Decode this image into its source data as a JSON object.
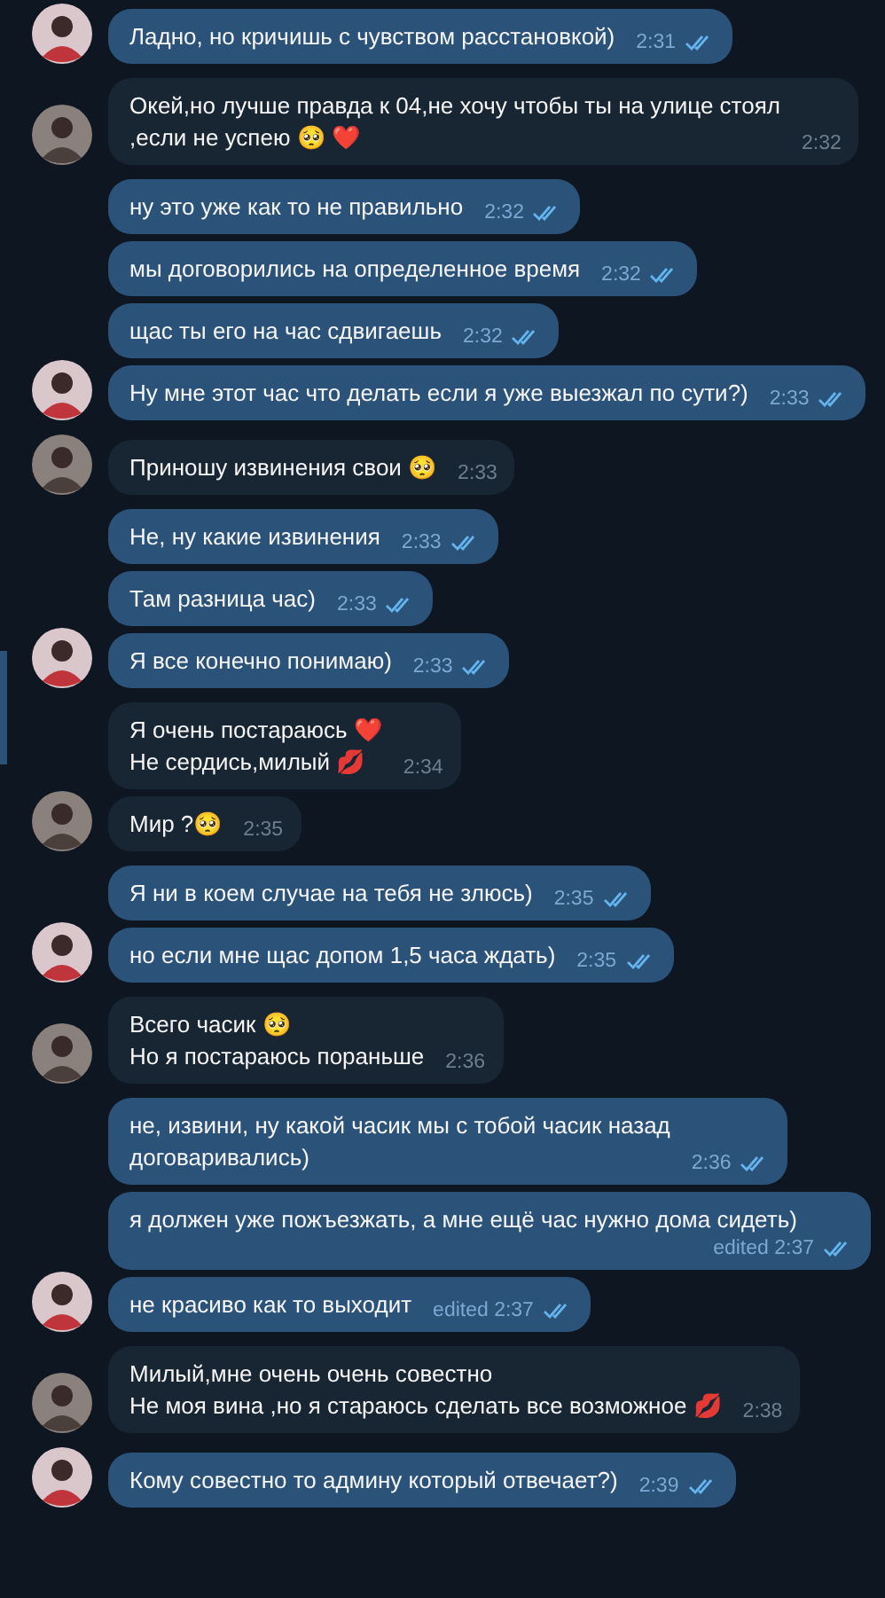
{
  "groups": [
    {
      "kind": "out",
      "messages": [
        {
          "text": "Ладно, но кричишь с чувством расстановкой)",
          "time": "2:31",
          "read": true
        }
      ]
    },
    {
      "kind": "in",
      "messages": [
        {
          "text": "Окей,но лучше правда к 04,не хочу чтобы ты на улице стоял\n,если не успею 🥺 ❤️",
          "time": "2:32"
        }
      ]
    },
    {
      "kind": "out",
      "messages": [
        {
          "text": "ну это уже как то не правильно",
          "time": "2:32",
          "read": true
        },
        {
          "text": "мы договорились на определенное время",
          "time": "2:32",
          "read": true
        },
        {
          "text": "щас ты его на час сдвигаешь",
          "time": "2:32",
          "read": true
        },
        {
          "text": "Ну мне этот час что делать если я уже выезжал по сути?)",
          "time": "2:33",
          "read": true
        }
      ]
    },
    {
      "kind": "in",
      "messages": [
        {
          "text": "Приношу извинения свои 🥺",
          "time": "2:33"
        }
      ]
    },
    {
      "kind": "out",
      "messages": [
        {
          "text": "Не, ну какие извинения",
          "time": "2:33",
          "read": true
        },
        {
          "text": "Там разница час)",
          "time": "2:33",
          "read": true
        },
        {
          "text": "Я все конечно понимаю)",
          "time": "2:33",
          "read": true
        }
      ]
    },
    {
      "kind": "in",
      "messages": [
        {
          "text": "Я очень постараюсь ❤️\nНе сердись,милый 💋",
          "time": "2:34"
        },
        {
          "text": "Мир ?🥺",
          "time": "2:35"
        }
      ]
    },
    {
      "kind": "out",
      "messages": [
        {
          "text": "Я ни в коем случае на тебя не злюсь)",
          "time": "2:35",
          "read": true
        },
        {
          "text": "но если мне щас допом 1,5 часа ждать)",
          "time": "2:35",
          "read": true
        }
      ]
    },
    {
      "kind": "in",
      "messages": [
        {
          "text": "Всего часик 🥺\nНо я постараюсь пораньше",
          "time": "2:36"
        }
      ]
    },
    {
      "kind": "out",
      "messages": [
        {
          "text": "не, извини, ну какой часик мы с тобой часик назад\nдоговаривались)",
          "time": "2:36",
          "read": true
        },
        {
          "text": "я должен уже пожъезжать, а мне ещё час нужно дома сидеть)",
          "time": "edited 2:37",
          "read": true
        },
        {
          "text": "не красиво как то выходит",
          "time": "edited 2:37",
          "read": true
        }
      ]
    },
    {
      "kind": "in",
      "messages": [
        {
          "text": "Милый,мне очень очень совестно\nНе моя вина ,но я стараюсь сделать все возможное 💋",
          "time": "2:38"
        }
      ]
    },
    {
      "kind": "out",
      "messages": [
        {
          "text": "Кому совестно то админу который отвечает?)",
          "time": "2:39",
          "read": true
        }
      ]
    }
  ]
}
